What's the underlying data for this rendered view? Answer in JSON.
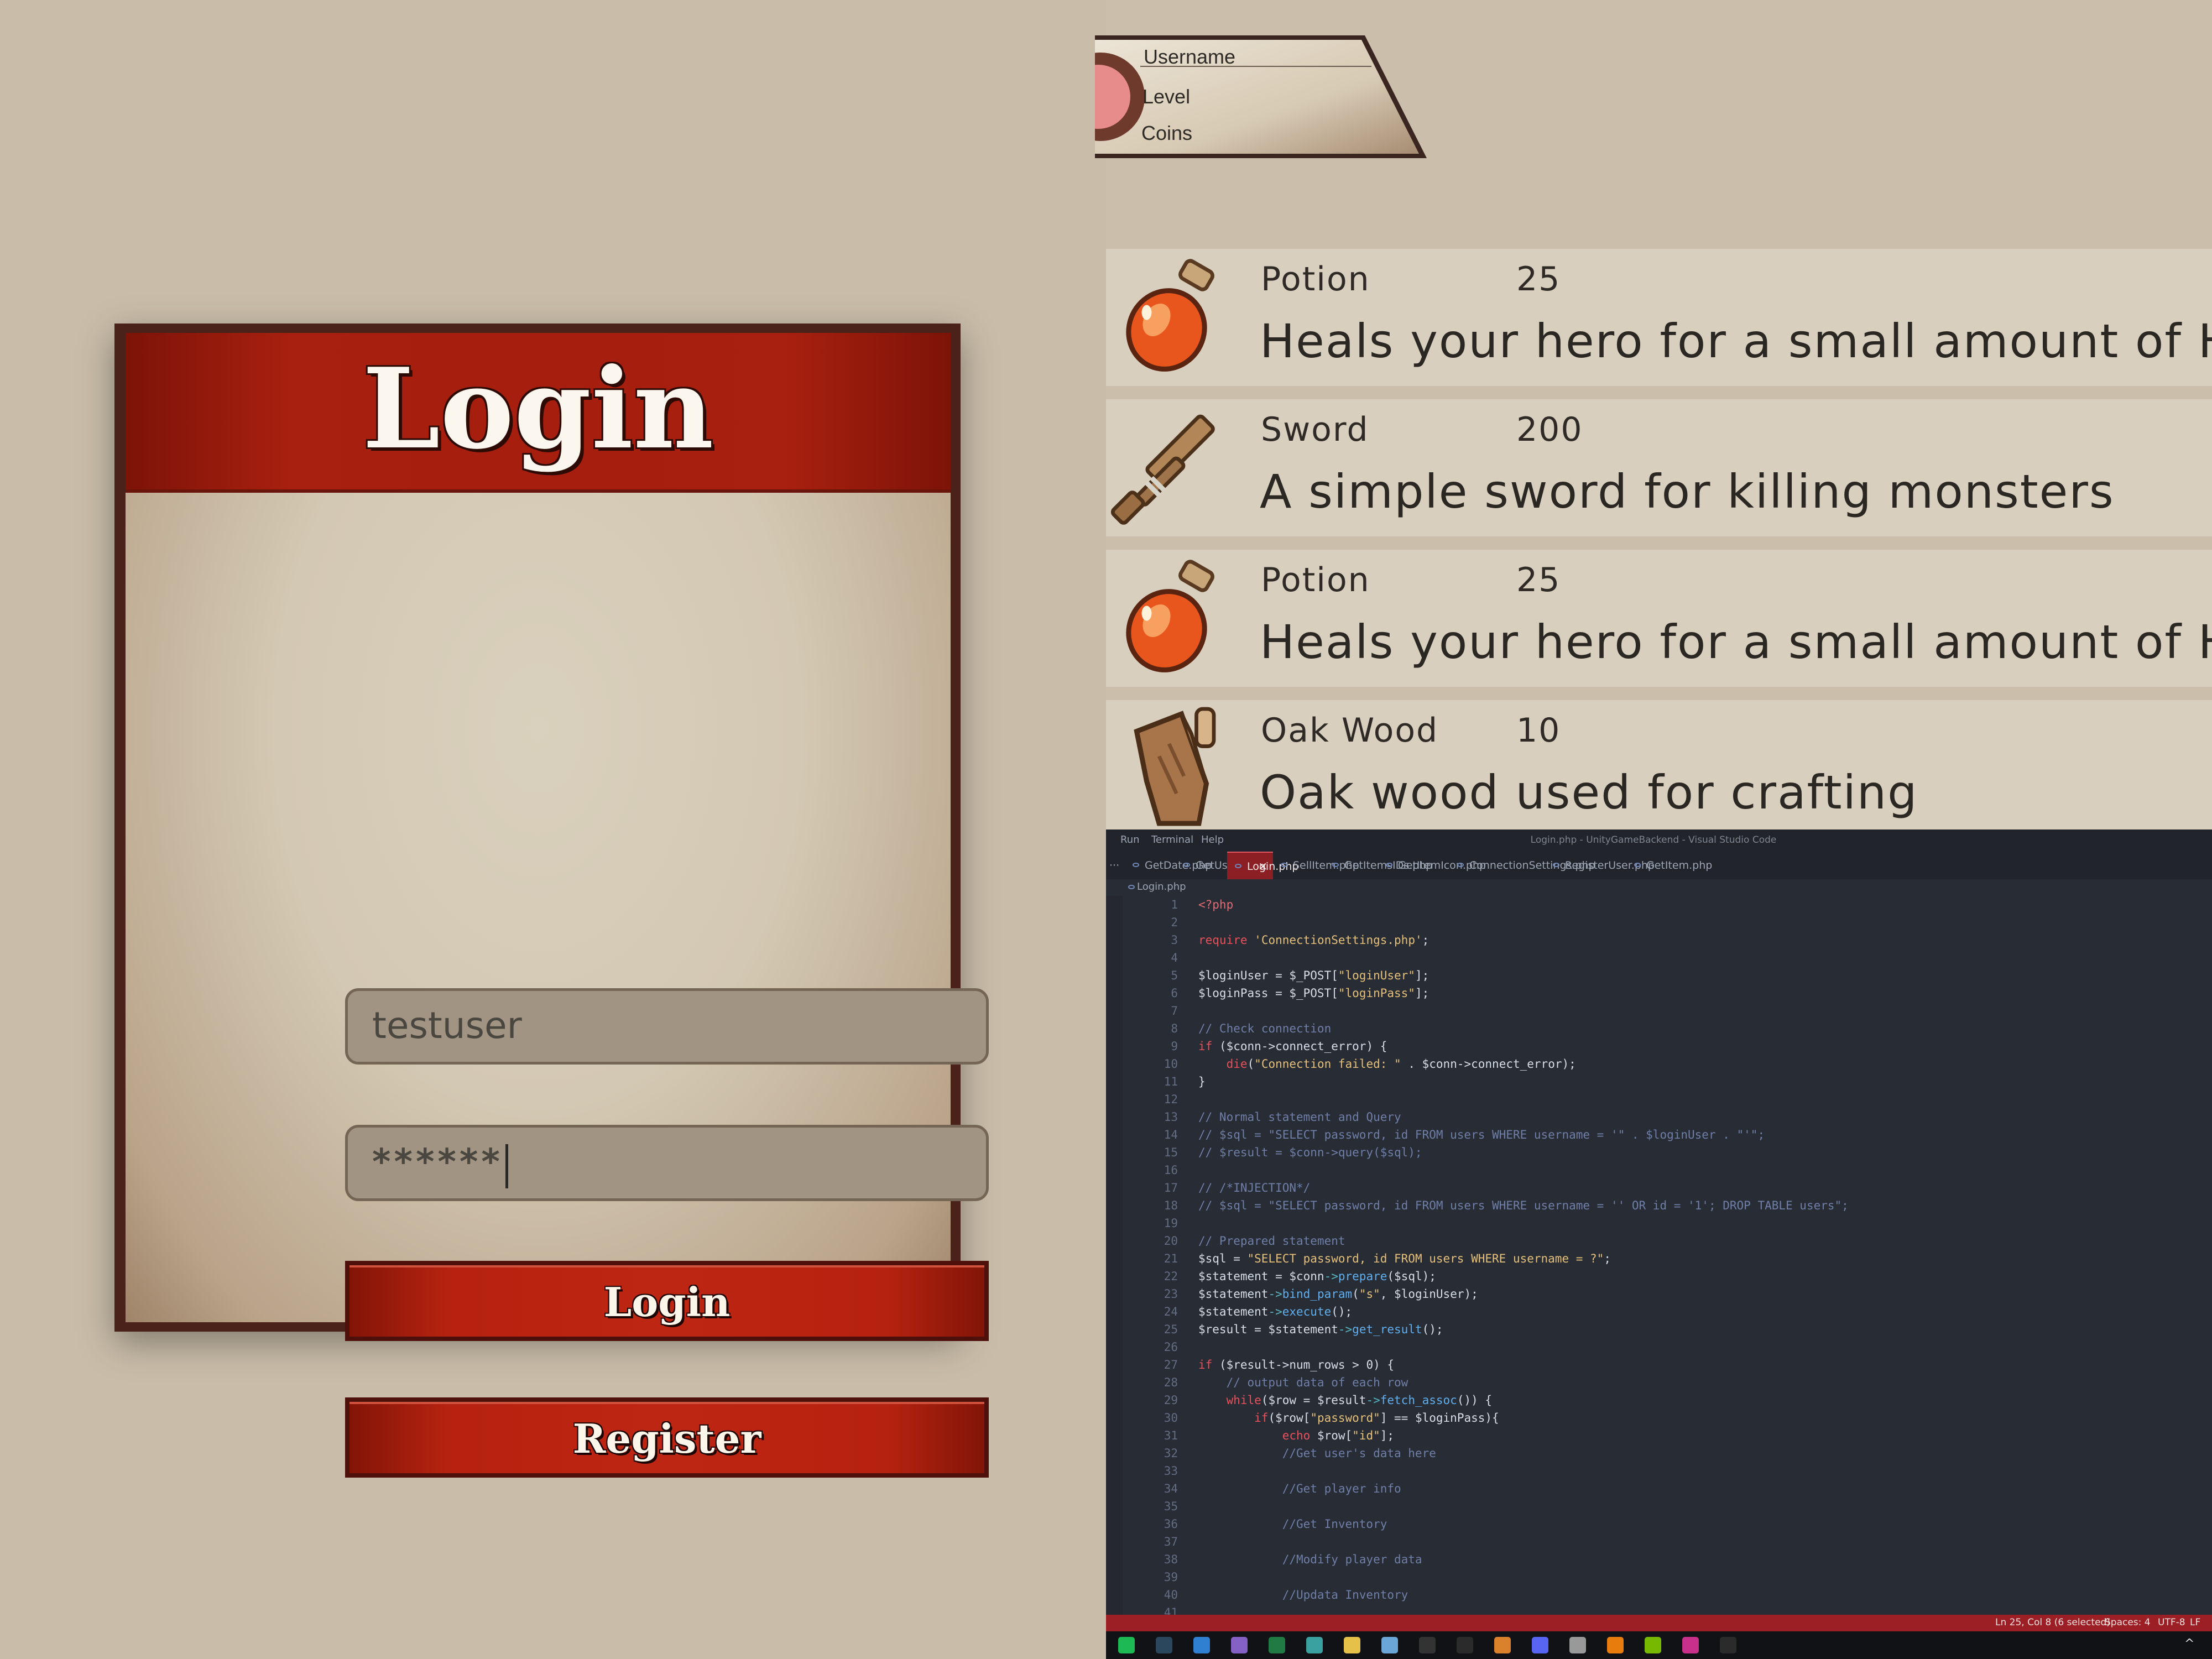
{
  "login": {
    "title": "Login",
    "username_value": "testuser",
    "password_value": "******",
    "login_button": "Login",
    "register_button": "Register"
  },
  "profile": {
    "username_label": "Username",
    "level_label": "Level",
    "coins_label": "Coins"
  },
  "items": [
    {
      "name": "Potion",
      "price": "25",
      "description": "Heals your hero for a small amount of HP",
      "icon": "potion-icon"
    },
    {
      "name": "Sword",
      "price": "200",
      "description": "A simple sword for killing monsters",
      "icon": "sword-icon"
    },
    {
      "name": "Potion",
      "price": "25",
      "description": "Heals your hero for a small amount of HP",
      "icon": "potion-icon"
    },
    {
      "name": "Oak Wood",
      "price": "10",
      "description": "Oak wood used for crafting",
      "icon": "oak-wood-icon"
    }
  ],
  "vscode": {
    "menu": [
      "Run",
      "Terminal",
      "Help"
    ],
    "window_title": "Login.php - UnityGameBackend - Visual Studio Code",
    "overflow": "···",
    "tabs": [
      "GetDate.php",
      "GetUsers.php",
      "Login.php",
      "SellItem.php",
      "GetItemsIDs.php",
      "GetItemIcon.php",
      "ConnectionSettings.php",
      "RegisterUser.php",
      "GetItem.php"
    ],
    "active_tab": "Login.php",
    "breadcrumb": "Login.php",
    "status": {
      "position": "Ln 25, Col 8 (6 selected)",
      "spaces": "Spaces: 4",
      "encoding": "UTF-8",
      "eol": "LF"
    },
    "code_lines": [
      "<?php",
      "",
      "require 'ConnectionSettings.php';",
      "",
      "$loginUser = $_POST[\"loginUser\"];",
      "$loginPass = $_POST[\"loginPass\"];",
      "",
      "// Check connection",
      "if ($conn->connect_error) {",
      "    die(\"Connection failed: \" . $conn->connect_error);",
      "}",
      "",
      "// Normal statement and Query",
      "// $sql = \"SELECT password, id FROM users WHERE username = '\" . $loginUser . \"'\";",
      "// $result = $conn->query($sql);",
      "",
      "// /*INJECTION*/",
      "// $sql = \"SELECT password, id FROM users WHERE username = '' OR id = '1'; DROP TABLE users\";",
      "",
      "// Prepared statement",
      "$sql = \"SELECT password, id FROM users WHERE username = ?\";",
      "$statement = $conn->prepare($sql);",
      "$statement->bind_param(\"s\", $loginUser);",
      "$statement->execute();",
      "$result = $statement->get_result();",
      "",
      "if ($result->num_rows > 0) {",
      "    // output data of each row",
      "    while($row = $result->fetch_assoc()) {",
      "        if($row[\"password\"] == $loginPass){",
      "            echo $row[\"id\"];",
      "            //Get user's data here",
      "",
      "            //Get player info",
      "",
      "            //Get Inventory",
      "",
      "            //Modify player data",
      "",
      "            //Updata Inventory",
      ""
    ],
    "taskbar_icons": [
      "spotify-icon",
      "steam-icon",
      "vscode-icon",
      "visual-studio-icon",
      "excel-icon",
      "unity-hub-icon",
      "app-icon",
      "network-icon",
      "epic-games-icon",
      "unity-icon",
      "fs-icon",
      "discord-icon",
      "clapper-icon",
      "blender-icon",
      "nvidia-icon",
      "app-icon",
      "unity-icon"
    ]
  },
  "colors": {
    "login_red": "#a8200f",
    "panel_cream": "#d9d0bd",
    "vscode_bg": "#282c34",
    "statusbar_red": "#9b1f25"
  }
}
